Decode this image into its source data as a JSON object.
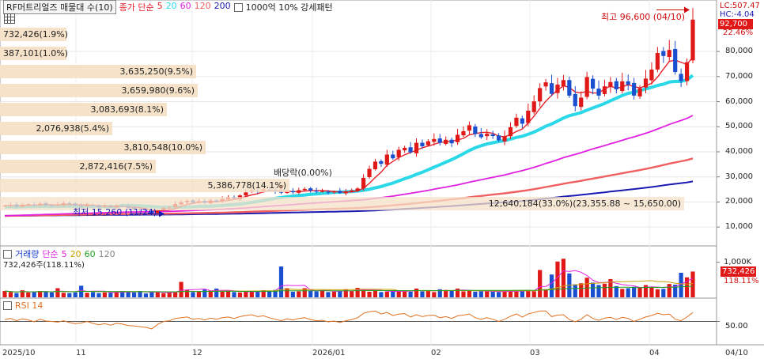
{
  "header": {
    "stock_name": "RF머트리얼즈 매물대 수(10)",
    "price_ma_label": "종가 단순",
    "ma_periods": [
      "5",
      "20",
      "60",
      "120",
      "200"
    ],
    "ma_colors": [
      "#e8202a",
      "#2ad8e8",
      "#e020e0",
      "#f06060",
      "#1a1ab0"
    ],
    "pattern_label": "1000억 10% 강세패턴"
  },
  "right_axis": {
    "lc": "LC:507.47",
    "hc": "HC:-4.04",
    "current_price": "92,700",
    "current_change": "22.46%",
    "price_ticks": [
      {
        "value": 80000,
        "label": "80,000"
      },
      {
        "value": 70000,
        "label": "70,000"
      },
      {
        "value": 60000,
        "label": "60,000"
      },
      {
        "value": 50000,
        "label": "50,000"
      },
      {
        "value": 40000,
        "label": "40,000"
      },
      {
        "value": 30000,
        "label": "30,000"
      },
      {
        "value": 20000,
        "label": "20,000"
      },
      {
        "value": 10000,
        "label": "10,000"
      }
    ],
    "volume_tick": "1,000K",
    "volume_current": "732,426",
    "volume_ratio": "118.11%",
    "rsi_tick": "50.00"
  },
  "volume_profile": [
    {
      "label": "732,426(1.9%)"
    },
    {
      "label": "387,101(1.0%)"
    },
    {
      "label": "3,635,250(9.5%)"
    },
    {
      "label": "3,659,980(9.6%)"
    },
    {
      "label": "3,083,693(8.1%)"
    },
    {
      "label": "2,076,938(5.4%)"
    },
    {
      "label": "3,810,548(10.0%)"
    },
    {
      "label": "2,872,416(7.5%)"
    },
    {
      "label": "5,386,778(14.1%)"
    },
    {
      "label": "12,640,184(33.0%)(23,355.88 ~ 15,650.00)"
    }
  ],
  "annotations": {
    "high": "최고 96,600 (04/10)",
    "low": "최저 15,260 (11/24)",
    "dividend": "배당락(0.00%)"
  },
  "volume_panel": {
    "title": "거래량",
    "ma_label": "단순",
    "ma_periods": [
      "5",
      "20",
      "60",
      "120"
    ],
    "value": "732,426주(118.11%)"
  },
  "rsi_panel": {
    "title": "RSI 14"
  },
  "x_axis": {
    "labels": [
      "2025/10",
      "11",
      "12",
      "2026/01",
      "02",
      "03",
      "04"
    ],
    "right_label": "04/10"
  },
  "chart_data": {
    "type": "candlestick",
    "title": "RF머트리얼즈",
    "period": [
      "2025/10",
      "04/10"
    ],
    "high": {
      "value": 96600,
      "date": "04/10"
    },
    "low": {
      "value": 15260,
      "date": "11/24"
    },
    "last_close": 92700,
    "y_range": [
      5000,
      98000
    ],
    "close_series": [
      18500,
      18800,
      18200,
      18900,
      19100,
      18700,
      19300,
      18800,
      18400,
      18900,
      19500,
      19200,
      18600,
      18200,
      18900,
      18600,
      17900,
      18400,
      17800,
      18600,
      18300,
      17600,
      17200,
      16900,
      16600,
      15600,
      16400,
      17600,
      17900,
      19200,
      19900,
      20400,
      19800,
      20300,
      19700,
      20600,
      20100,
      21200,
      21800,
      21400,
      22600,
      23800,
      24600,
      24200,
      25100,
      24700,
      24100,
      23700,
      24200,
      23900,
      24700,
      25200,
      24600,
      24100,
      24300,
      23800,
      24100,
      23600,
      24200,
      24600,
      25400,
      29600,
      33200,
      36100,
      35200,
      38900,
      37400,
      40800,
      41600,
      39800,
      43600,
      42200,
      44200,
      45100,
      43600,
      44800,
      43400,
      46800,
      48200,
      50600,
      47100,
      45800,
      47200,
      46300,
      44600,
      46200,
      49800,
      53600,
      51200,
      56400,
      60100,
      65400,
      67700,
      63100,
      66800,
      68600,
      62400,
      58200,
      61600,
      69800,
      65200,
      62400,
      66100,
      67800,
      64900,
      68100,
      66800,
      62400,
      65300,
      69200,
      72800,
      79400,
      78200,
      80600,
      71800,
      68200,
      75700,
      92700
    ],
    "volume_series": [
      180,
      150,
      120,
      200,
      140,
      160,
      180,
      150,
      140,
      260,
      130,
      120,
      140,
      330,
      130,
      150,
      120,
      140,
      130,
      160,
      180,
      150,
      140,
      180,
      110,
      160,
      150,
      120,
      130,
      160,
      440,
      210,
      150,
      170,
      220,
      190,
      250,
      160,
      180,
      150,
      140,
      170,
      180,
      160,
      200,
      170,
      210,
      880,
      260,
      160,
      170,
      260,
      180,
      170,
      200,
      150,
      160,
      190,
      230,
      170,
      270,
      220,
      160,
      200,
      150,
      160,
      170,
      180,
      200,
      160,
      250,
      170,
      180,
      150,
      230,
      210,
      180,
      250,
      170,
      190,
      160,
      170,
      180,
      160,
      150,
      170,
      180,
      190,
      200,
      180,
      170,
      780,
      230,
      650,
      1020,
      1100,
      680,
      370,
      400,
      560,
      420,
      350,
      390,
      520,
      320,
      240,
      260,
      300,
      280,
      350,
      300,
      230,
      240,
      380,
      360,
      700,
      570,
      735
    ],
    "rsi_series": [
      55,
      58,
      52,
      57,
      54,
      49,
      56,
      51,
      50,
      48,
      52,
      47,
      44,
      46,
      50,
      45,
      41,
      44,
      40,
      45,
      43,
      39,
      38,
      36,
      34,
      30,
      42,
      50,
      52,
      58,
      60,
      62,
      56,
      58,
      54,
      59,
      56,
      60,
      62,
      58,
      63,
      66,
      68,
      63,
      65,
      60,
      56,
      52,
      57,
      54,
      58,
      60,
      55,
      52,
      53,
      49,
      51,
      47,
      52,
      55,
      60,
      72,
      76,
      78,
      70,
      74,
      66,
      70,
      71,
      62,
      68,
      63,
      66,
      67,
      60,
      63,
      58,
      65,
      67,
      70,
      60,
      56,
      60,
      56,
      50,
      56,
      64,
      70,
      62,
      70,
      74,
      78,
      78,
      63,
      67,
      68,
      55,
      49,
      56,
      68,
      58,
      53,
      59,
      61,
      55,
      61,
      58,
      50,
      56,
      62,
      66,
      72,
      68,
      70,
      56,
      52,
      62,
      74
    ],
    "rsi_reference": 50,
    "volume_tick_value_k": 1000,
    "volume_last": 732426,
    "volume_ratio_pct": 118.11,
    "volume_profile_pct": [
      1.9,
      1.0,
      9.5,
      9.6,
      8.1,
      5.4,
      10.0,
      7.5,
      14.1,
      33.0
    ],
    "volume_profile_bands": [
      [
        92000,
        97000
      ],
      [
        84000,
        91000
      ],
      [
        76000,
        83000
      ],
      [
        67000,
        75000
      ],
      [
        58000,
        66000
      ],
      [
        50000,
        57000
      ],
      [
        42000,
        49000
      ],
      [
        33000,
        41000
      ],
      [
        24000,
        32000
      ],
      [
        15650,
        23355.88
      ]
    ],
    "dividend_date_index": 47
  }
}
